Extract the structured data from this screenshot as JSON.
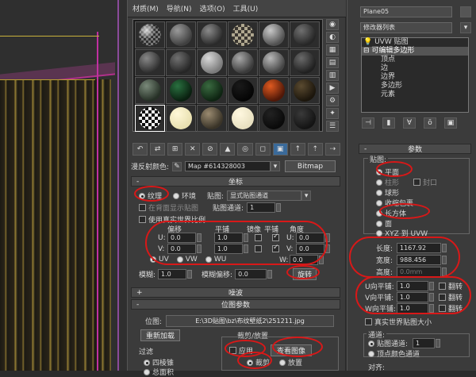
{
  "menubar": {
    "items": [
      "材质(M)",
      "导航(N)",
      "选项(O)",
      "工具(U)"
    ]
  },
  "slots": [
    {
      "c1": "#7a7a7a",
      "c2": "#303030",
      "pattern": "checker-light"
    },
    {
      "c1": "#9a9a9a",
      "c2": "#404040",
      "pattern": "plain"
    },
    {
      "c1": "#8a8a8a",
      "c2": "#2a2a2a",
      "pattern": "plain"
    },
    {
      "c1": "#b0a890",
      "c2": "#3a3630",
      "pattern": "checker"
    },
    {
      "c1": "#c8c8c8",
      "c2": "#505050",
      "pattern": "plain"
    },
    {
      "c1": "#707070",
      "c2": "#262626",
      "pattern": "plain"
    },
    {
      "c1": "#888888",
      "c2": "#2c2c2c",
      "pattern": "plain"
    },
    {
      "c1": "#707070",
      "c2": "#262626",
      "pattern": "plain"
    },
    {
      "c1": "#d8d8d8",
      "c2": "#7a7a7a",
      "pattern": "plain"
    },
    {
      "c1": "#a8a8a8",
      "c2": "#3a3a3a",
      "pattern": "plain"
    },
    {
      "c1": "#b8b8b8",
      "c2": "#444444",
      "pattern": "plain"
    },
    {
      "c1": "#6a6a6a",
      "c2": "#202020",
      "pattern": "plain"
    },
    {
      "c1": "#7a8a7a",
      "c2": "#263026",
      "pattern": "plain"
    },
    {
      "c1": "#2a7040",
      "c2": "#0a2010",
      "pattern": "plain"
    },
    {
      "c1": "#3a6a40",
      "c2": "#0e2412",
      "pattern": "plain"
    },
    {
      "c1": "#1a1a1a",
      "c2": "#050505",
      "pattern": "plain"
    },
    {
      "c1": "#e05a20",
      "c2": "#501808",
      "pattern": "plain"
    },
    {
      "c1": "#5a4a30",
      "c2": "#1c160c",
      "pattern": "plain"
    },
    {
      "c1": "#f0f0f0",
      "c2": "#101010",
      "pattern": "checker"
    },
    {
      "c1": "#fff8d8",
      "c2": "#e8e0b0",
      "pattern": "plain"
    },
    {
      "c1": "#9a8a70",
      "c2": "#3a3428",
      "pattern": "plain"
    },
    {
      "c1": "#fff8e0",
      "c2": "#e8e0c0",
      "pattern": "plain"
    },
    {
      "c1": "#222222",
      "c2": "#0a0a0a",
      "pattern": "plain"
    },
    {
      "c1": "#3a3a3a",
      "c2": "#141414",
      "pattern": "plain"
    }
  ],
  "map_row": {
    "label": "漫反射颜色:",
    "map_name": "Map #614328003",
    "map_type": "Bitmap"
  },
  "coords": {
    "title": "坐标",
    "texture": "纹理",
    "environ": "环境",
    "mapping_label": "贴图:",
    "mapping_value": "显式贴图通道",
    "hidden_text": "在背面显示贴图",
    "map_channel_label": "贴图通道:",
    "map_channel_value": "1",
    "use_real_world": "使用真实世界比例",
    "col_offset": "偏移",
    "col_tiling": "平铺",
    "col_mirror": "镜像",
    "col_tile": "平铺",
    "col_angle": "角度",
    "u_label": "U:",
    "v_label": "V:",
    "w_label": "W:",
    "u_offset": "0.0",
    "v_offset": "0.0",
    "u_tiling": "1.0",
    "v_tiling": "1.0",
    "u_angle": "0.0",
    "v_angle": "0.0",
    "w_angle": "0.0",
    "uv": "UV",
    "vw": "VW",
    "wu": "WU",
    "blur_label": "模糊:",
    "blur_value": "1.0",
    "blur_offset_label": "模糊偏移:",
    "blur_offset_value": "0.0",
    "rotate": "旋转"
  },
  "noise": {
    "title": "噪波",
    "sign": "+"
  },
  "bitmap_params": {
    "title": "位图参数",
    "sign": "-",
    "bitmap_label": "位图:",
    "bitmap_path": "E:\\3D贴图\\bz\\布纹壁纸2\\251211.jpg",
    "reload": "重新加载",
    "crop_place": "裁剪/放置",
    "apply": "应用",
    "view_image": "查看图像",
    "filter_label": "过滤",
    "pyramid": "四棱锥",
    "sum_area": "总面积",
    "crop": "裁剪",
    "place": "放置"
  },
  "cmd": {
    "object_name": "Plane05",
    "modifier_list": "修改器列表",
    "stack": [
      "UVW 贴图",
      "可编辑多边形",
      "顶点",
      "边",
      "边界",
      "多边形",
      "元素"
    ],
    "params_title": "参数",
    "mapping_title": "贴图:",
    "plane": "平面",
    "cylinder": "柱形",
    "cap": "封口",
    "sphere": "球形",
    "shrink_wrap": "收缩包裹",
    "box": "长方体",
    "face": "面",
    "xyz_uvw": "XYZ 到 UVW",
    "length_label": "长度:",
    "length_value": "1167.92",
    "width_label": "宽度:",
    "width_value": "988.456",
    "height_label": "高度:",
    "height_value": "0.0mm",
    "u_tile_label": "U向平铺:",
    "u_tile_value": "1.0",
    "v_tile_label": "V向平铺:",
    "v_tile_value": "1.0",
    "w_tile_label": "W向平铺:",
    "w_tile_value": "1.0",
    "flip": "翻转",
    "real_world": "真实世界贴图大小",
    "channel_title": "通道:",
    "map_channel": "贴图通道:",
    "map_channel_value": "1",
    "vertex_color": "顶点颜色通道",
    "align_title": "对齐:"
  },
  "colors": {
    "annotation_red": "#d81818",
    "panel_bg": "#3b3b3b"
  }
}
